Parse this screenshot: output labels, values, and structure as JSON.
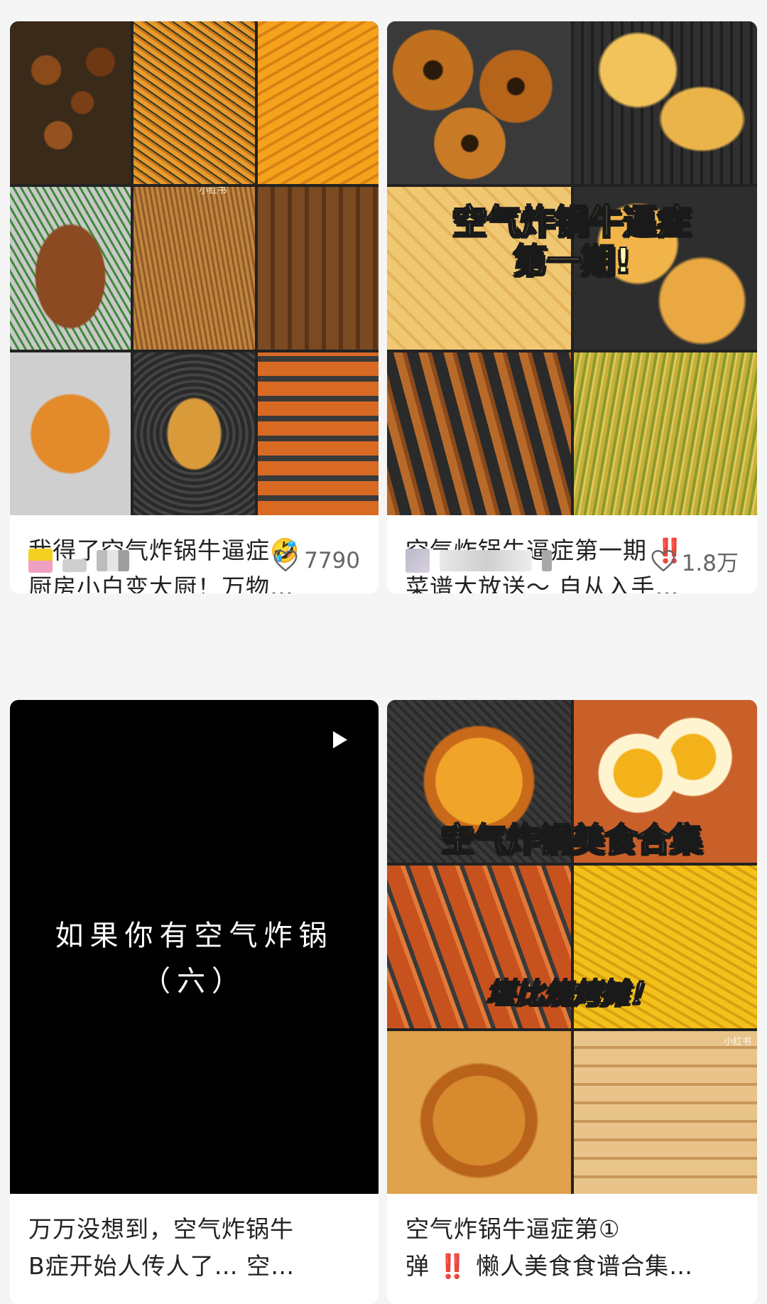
{
  "feed": {
    "cards": [
      {
        "title": "我得了空气炸锅牛逼症🤣\n厨房小白变大厨！万物…",
        "likes": "7790",
        "watermark": "小红书"
      },
      {
        "title": "空气炸锅牛逼症第一期 ‼️\n菜谱大放送～ 自从入手…",
        "likes": "1.8万",
        "overlay": "空气炸锅牛逼症\n第一期!"
      },
      {
        "title": "万万没想到，空气炸锅牛\nB症开始人传人了… 空…",
        "video_text": "如果你有空气炸锅\n（六）",
        "is_video": true
      },
      {
        "title": "空气炸锅牛逼症第①\n弹 ‼️ 懒人美食食谱合集…",
        "overlay_top": "空气炸锅美食合集",
        "overlay_mid": "堪比烧烤摊！",
        "watermark": "小红书"
      }
    ]
  },
  "icons": {
    "like": "heart-outline-icon",
    "play": "play-icon"
  },
  "colors": {
    "background": "#f5f5f5",
    "card": "#ffffff",
    "text": "#222222",
    "muted": "#666666"
  }
}
